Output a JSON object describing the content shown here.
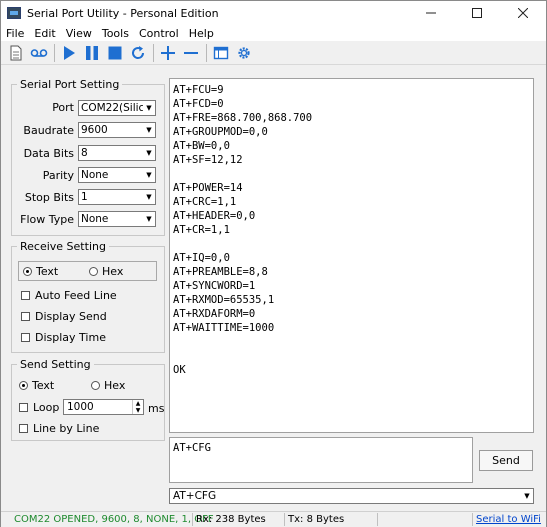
{
  "window": {
    "title": "Serial Port Utility - Personal Edition"
  },
  "menu": [
    "File",
    "Edit",
    "View",
    "Tools",
    "Control",
    "Help"
  ],
  "toolbar_icons": [
    "document-icon",
    "recording-icon",
    "play-icon",
    "pause-icon",
    "stop-icon",
    "refresh-icon",
    "add-icon",
    "remove-icon",
    "window-icon",
    "settings-gear-icon"
  ],
  "serial_port_setting": {
    "title": "Serial Port Setting",
    "port_label": "Port",
    "port_value": "COM22(Silic",
    "baudrate_label": "Baudrate",
    "baudrate_value": "9600",
    "databits_label": "Data Bits",
    "databits_value": "8",
    "parity_label": "Parity",
    "parity_value": "None",
    "stopbits_label": "Stop Bits",
    "stopbits_value": "1",
    "flowtype_label": "Flow Type",
    "flowtype_value": "None"
  },
  "receive_setting": {
    "title": "Receive Setting",
    "text_label": "Text",
    "hex_label": "Hex",
    "selected": "Text",
    "auto_feed_line": "Auto Feed Line",
    "display_send": "Display Send",
    "display_time": "Display Time"
  },
  "send_setting": {
    "title": "Send Setting",
    "text_label": "Text",
    "hex_label": "Hex",
    "selected": "Text",
    "loop_label": "Loop",
    "loop_value": "1000",
    "loop_unit": "ms",
    "line_by_line": "Line by Line"
  },
  "receive_text": "AT+FCU=9\nAT+FCD=0\nAT+FRE=868.700,868.700\nAT+GROUPMOD=0,0\nAT+BW=0,0\nAT+SF=12,12\n\nAT+POWER=14\nAT+CRC=1,1\nAT+HEADER=0,0\nAT+CR=1,1\n\nAT+IQ=0,0\nAT+PREAMBLE=8,8\nAT+SYNCWORD=1\nAT+RXMOD=65535,1\nAT+RXDAFORM=0\nAT+WAITTIME=1000\n\n\nOK",
  "send_text": "AT+CFG",
  "send_button": "Send",
  "command_history": "AT+CFG",
  "status": {
    "connection": "COM22 OPENED, 9600, 8, NONE, 1, OFF",
    "rx": "Rx: 238 Bytes",
    "tx": "Tx: 8 Bytes",
    "link": "Serial to WiFi"
  },
  "colors": {
    "status_green": "#1e8a2e",
    "play_blue": "#1f6fd1",
    "link_blue": "#0044cc"
  }
}
